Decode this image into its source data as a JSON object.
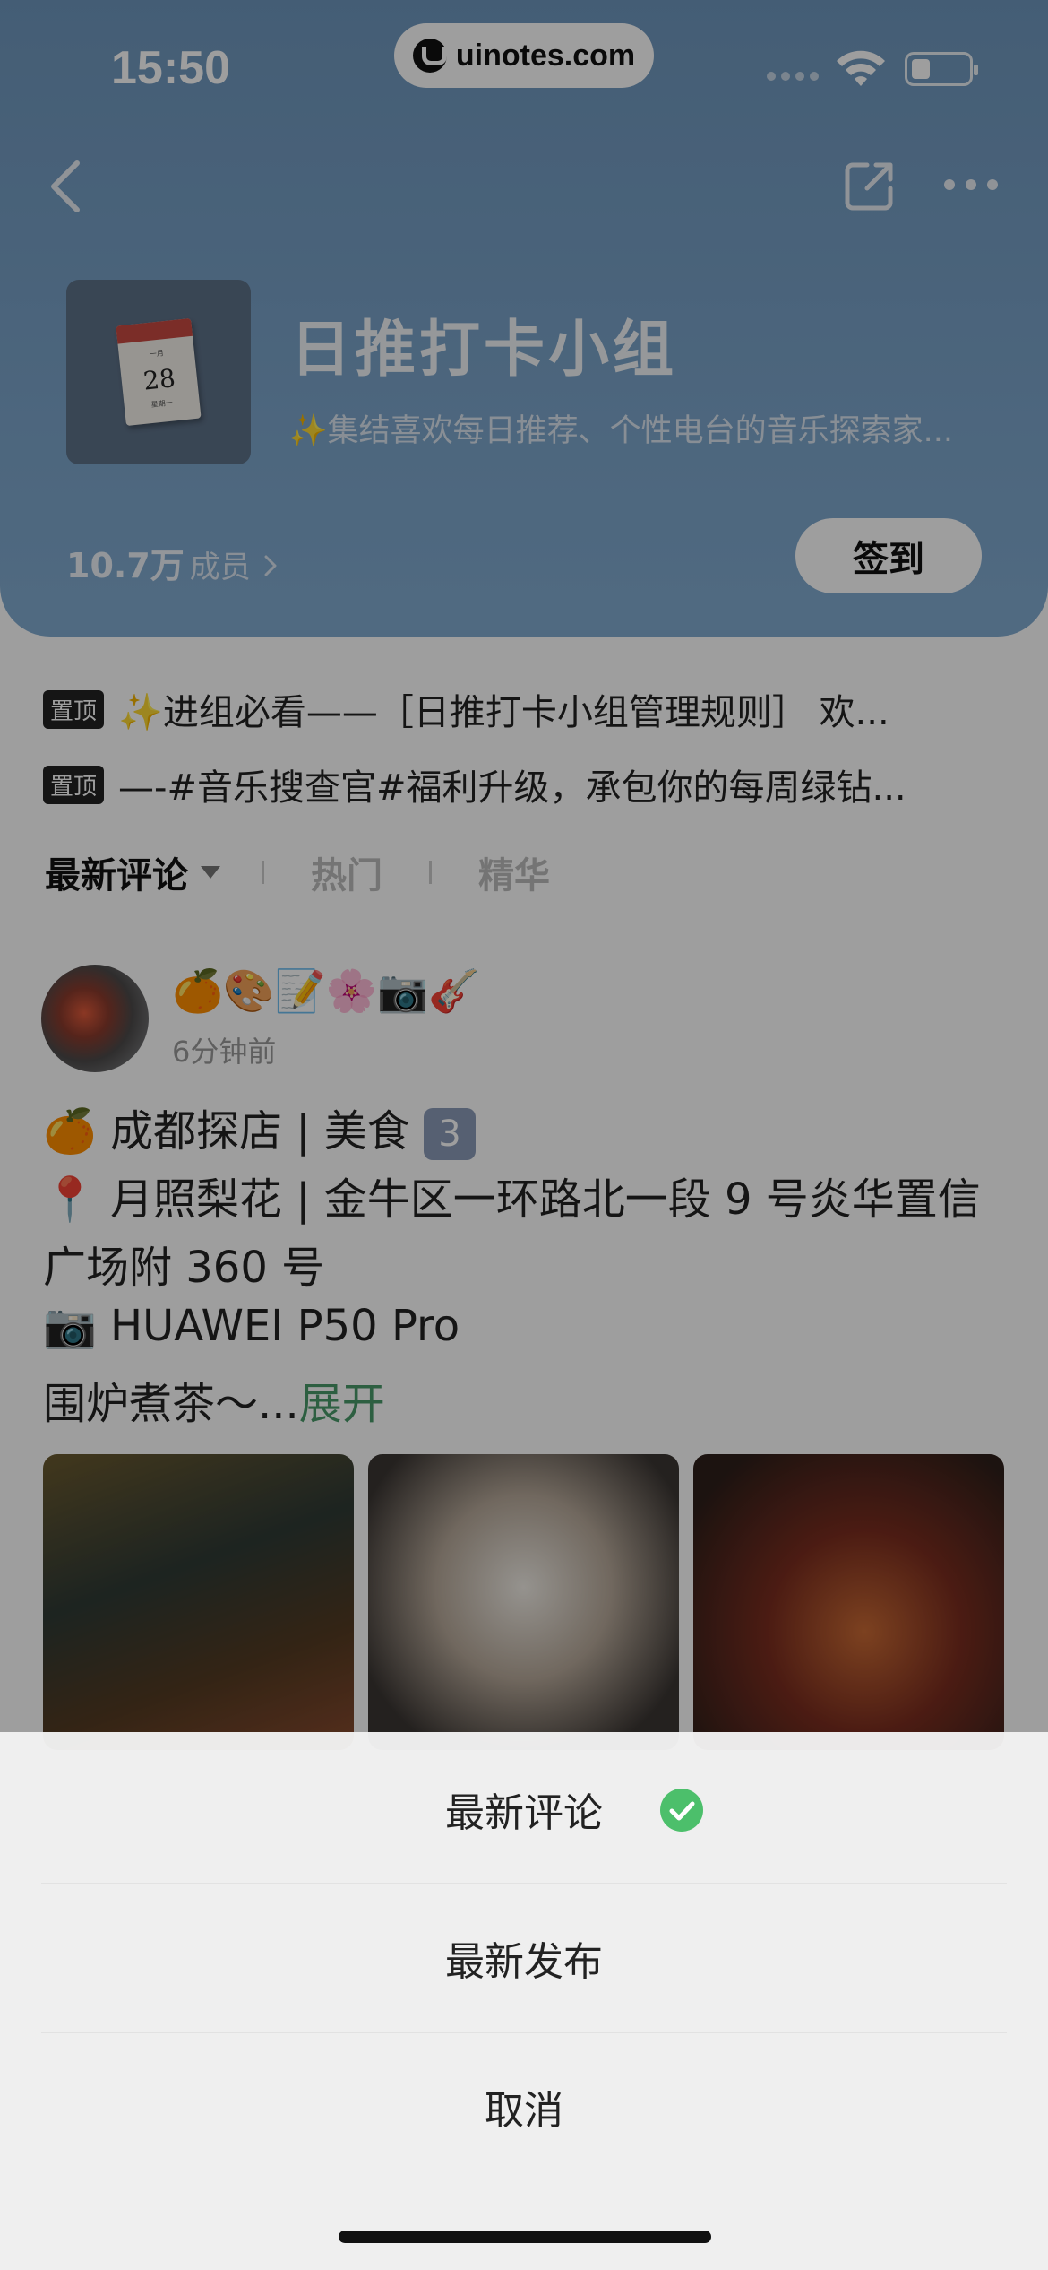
{
  "status_bar": {
    "time": "15:50",
    "site": "uinotes.com"
  },
  "header": {
    "group_title": "日推打卡小组",
    "group_desc": "✨集结喜欢每日推荐、个性电台的音乐探索家...",
    "member_count": "10.7万",
    "member_label": "成员",
    "checkin_label": "签到",
    "cover": {
      "small_text": "一月",
      "day": "28",
      "weekday": "星期一"
    }
  },
  "pinned": [
    {
      "tag": "置顶",
      "text": "✨进组必看——［日推打卡小组管理规则］ 欢..."
    },
    {
      "tag": "置顶",
      "text": "—-#音乐搜查官#福利升级，承包你的每周绿钻..."
    }
  ],
  "tabs": {
    "latest_comment": "最新评论",
    "hot": "热门",
    "featured": "精华"
  },
  "post": {
    "emojis": "🍊🎨📝🌸📷🎸",
    "time": "6分钟前",
    "line1": "🍊 成都探店 | 美食",
    "badge": "3",
    "line2": "📍 月照梨花 | 金牛区一环路北一段 9 号炎华置信",
    "line3": "广场附 360 号",
    "line4": "📷 HUAWEI P50 Pro",
    "line5": "围炉煮茶～...",
    "expand": "展开"
  },
  "sheet": {
    "option_latest_comment": "最新评论",
    "option_latest_publish": "最新发布",
    "cancel": "取消"
  },
  "colors": {
    "header_bg": "#7aa3c9",
    "accent_green": "#4cbf6b",
    "expand_green": "#4a9a6a"
  }
}
